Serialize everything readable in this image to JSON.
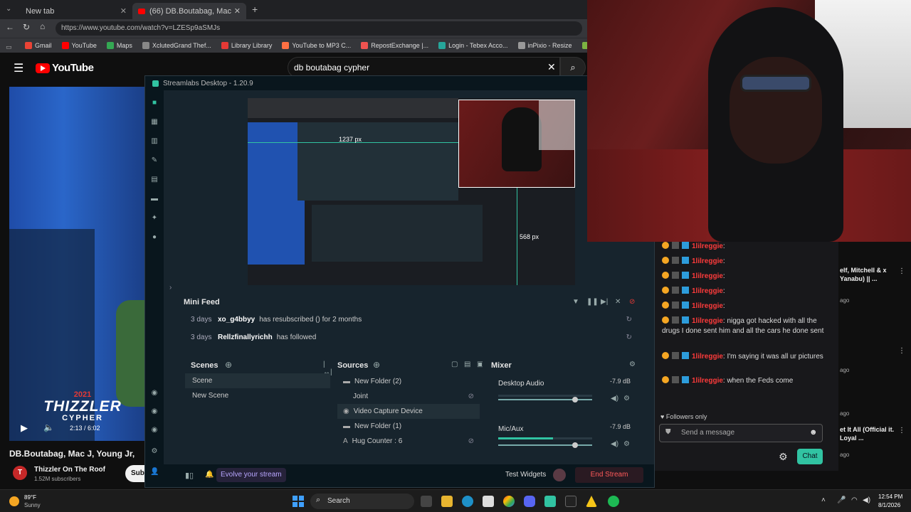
{
  "chrome": {
    "tabs": [
      {
        "label": "New tab"
      },
      {
        "label": "(66) DB.Boutabag, Mac J, Young J..."
      }
    ],
    "url": "https://www.youtube.com/watch?v=LZESp9aSMJs",
    "bookmarks": [
      {
        "label": "Gmail",
        "color": "#ea4335"
      },
      {
        "label": "YouTube",
        "color": "#ff0000"
      },
      {
        "label": "Maps",
        "color": "#34a853"
      },
      {
        "label": "XclutedGrand Thef...",
        "color": "#888"
      },
      {
        "label": "Library Library",
        "color": "#e53935"
      },
      {
        "label": "YouTube to MP3 C...",
        "color": "#ff7043"
      },
      {
        "label": "RepostExchange |...",
        "color": "#ef5350"
      },
      {
        "label": "Login - Tebex Acco...",
        "color": "#26a69a"
      },
      {
        "label": "inPixio - Resize",
        "color": "#999"
      },
      {
        "label": "Twitch Emote R...",
        "color": "#7cb342"
      }
    ]
  },
  "youtube": {
    "logo": "YouTube",
    "search": "db boutabag cypher",
    "video_title": "DB.Boutabag, Mac J, Young Jr,",
    "channel": "Thizzler On The Roof",
    "subscribers": "1.52M subscribers",
    "subscribe_label": "Sub",
    "time": "2:13 / 6:02",
    "thumb_year": "2021",
    "thumb_title": "THIZZLER",
    "thumb_sub": "CYPHER",
    "side_videos": [
      {
        "title": "elf, Mitchell & x Yanabu) || ...",
        "age": "ago"
      },
      {
        "title": "",
        "age": "ago"
      },
      {
        "title": "",
        "age": "ago"
      },
      {
        "title": "et It All (Official it. Loyal ...",
        "age": "ago"
      }
    ]
  },
  "streamlabs": {
    "title": "Streamlabs Desktop - 1.20.9",
    "preview_text_1": "1237 px",
    "preview_text_2": "568 px",
    "mini_feed": {
      "title": "Mini Feed",
      "events": [
        {
          "time": "3 days",
          "user": "xo_g4bbyy",
          "text": "has resubscribed () for 2 months"
        },
        {
          "time": "3 days",
          "user": "Rellzfinallyrichh",
          "text": "has followed"
        }
      ]
    },
    "scenes": {
      "title": "Scenes",
      "items": [
        "Scene",
        "New Scene"
      ]
    },
    "sources": {
      "title": "Sources",
      "items": [
        "New Folder (2)",
        "Joint",
        "Video Capture Device",
        "New Folder (1)",
        "Hug Counter : 6"
      ]
    },
    "mixer": {
      "title": "Mixer",
      "channels": [
        {
          "name": "Desktop Audio",
          "db": "-7.9 dB",
          "level": 0.0
        },
        {
          "name": "Mic/Aux",
          "db": "-7.9 dB",
          "level": 0.58
        }
      ]
    },
    "footer": {
      "evolve": "Evolve your stream",
      "test_widgets": "Test Widgets",
      "end_stream": "End Stream"
    }
  },
  "chat": {
    "messages": [
      {
        "user": "1lilreggie",
        "text": ":"
      },
      {
        "user": "1lilreggie",
        "text": ":"
      },
      {
        "user": "1lilreggie",
        "text": ":"
      },
      {
        "user": "1lilreggie",
        "text": ":"
      },
      {
        "user": "1lilreggie",
        "text": ":"
      },
      {
        "user": "1lilreggie",
        "text": ": nigga got hacked with all the drugs I done sent him and all the cars he done sent"
      },
      {
        "user": "1lilreggie",
        "text": ": I'm saying it was all ur pictures"
      },
      {
        "user": "1lilreggie",
        "text": ": when the Feds come"
      }
    ],
    "followers_only": "Followers only",
    "placeholder": "Send a message",
    "chat_button": "Chat"
  },
  "taskbar": {
    "weather_temp": "89°F",
    "weather_desc": "Sunny",
    "search": "Search",
    "time": "12:54 PM",
    "date": "8/1/2026"
  }
}
